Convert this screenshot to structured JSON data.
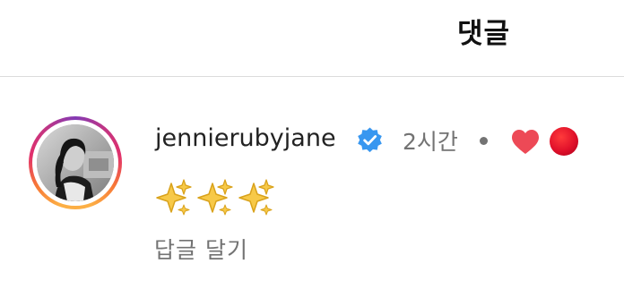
{
  "header": {
    "title": "댓글"
  },
  "comment": {
    "username": "jennierubyjane",
    "time": "2시간",
    "text_icons": [
      "sparkles-icon",
      "sparkles-icon",
      "sparkles-icon"
    ],
    "reply_label": "답글 달기"
  },
  "colors": {
    "verified_badge": "#3897f0",
    "heart": "#ed4956",
    "reaction_dot": "#e0102a",
    "muted_text": "#737373"
  }
}
